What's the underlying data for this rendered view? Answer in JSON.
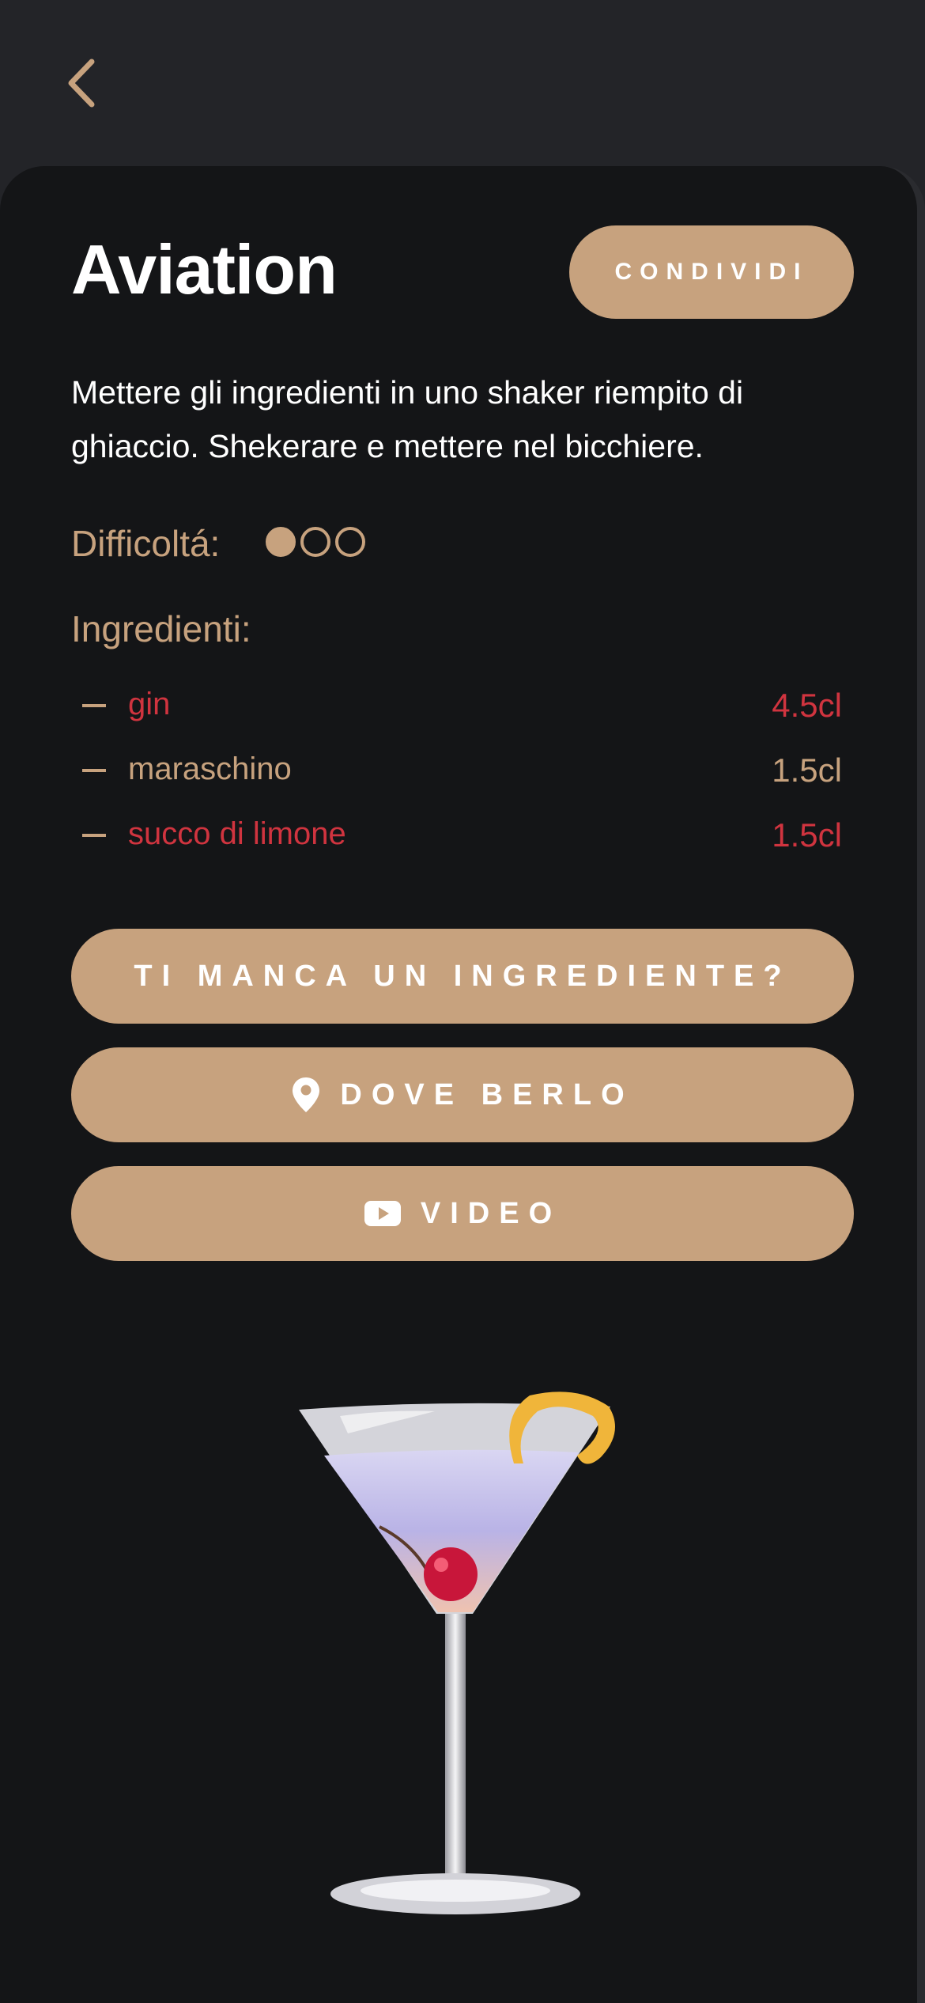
{
  "cocktail": {
    "name": "Aviation",
    "description": "Mettere gli ingredienti in uno shaker riempito di ghiaccio. Shekerare e mettere nel bicchiere.",
    "difficulty_label": "Difficoltá:",
    "difficulty_level": 1,
    "difficulty_max": 3,
    "ingredients_title": "Ingredienti:",
    "ingredients": [
      {
        "name": "gin",
        "quantity": "4.5cl",
        "status": "missing"
      },
      {
        "name": "maraschino",
        "quantity": "1.5cl",
        "status": "available"
      },
      {
        "name": "succo di limone",
        "quantity": "1.5cl",
        "status": "missing"
      }
    ]
  },
  "actions": {
    "share": "CONDIVIDI",
    "missing_ingredient": "TI MANCA UN INGREDIENTE?",
    "where_to_drink": "DOVE BERLO",
    "video": "VIDEO"
  },
  "icons": {
    "back": "chevron-left-icon",
    "location": "map-pin-icon",
    "video": "youtube-icon"
  },
  "colors": {
    "accent": "#c7a27e",
    "missing": "#d0343f",
    "background": "#141517",
    "header": "#232428"
  }
}
